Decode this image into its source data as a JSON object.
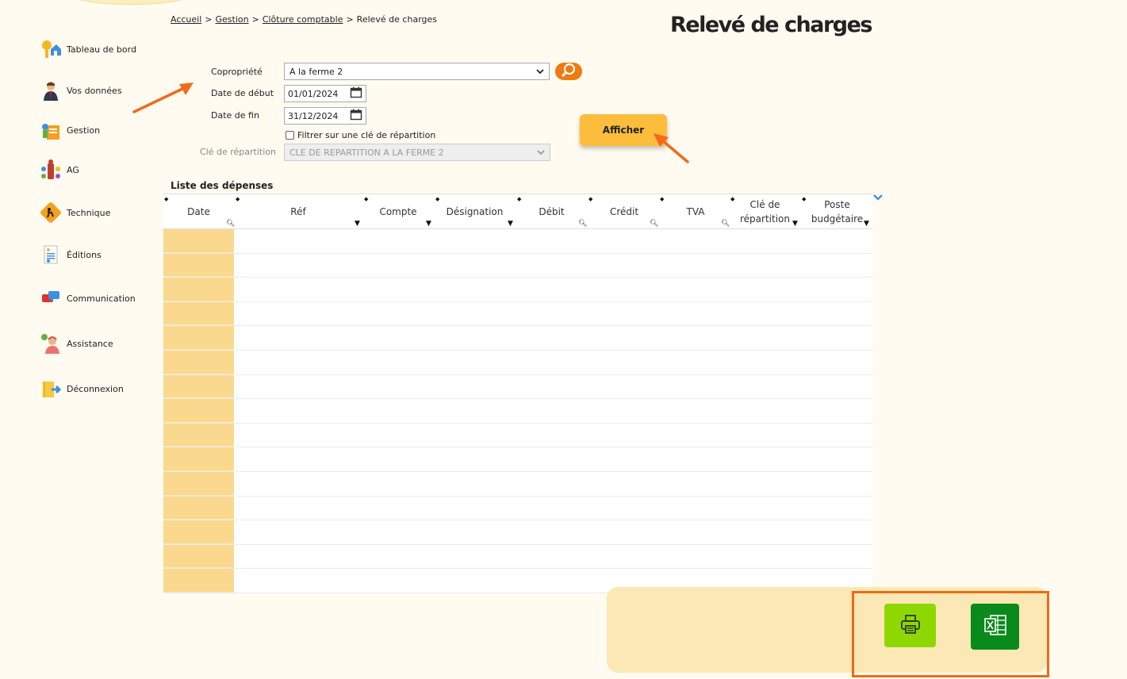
{
  "breadcrumb": {
    "items": [
      "Accueil",
      "Gestion",
      "Clôture comptable"
    ],
    "current": "Relevé de charges",
    "separator": ">"
  },
  "page_title": "Relevé de charges",
  "sidebar": {
    "items": [
      {
        "label": "Tableau de bord",
        "icon": "dashboard-icon"
      },
      {
        "label": "Vos données",
        "icon": "user-icon"
      },
      {
        "label": "Gestion",
        "icon": "management-icon"
      },
      {
        "label": "AG",
        "icon": "meeting-icon"
      },
      {
        "label": "Technique",
        "icon": "worker-icon"
      },
      {
        "label": "Éditions",
        "icon": "document-icon"
      },
      {
        "label": "Communication",
        "icon": "chat-icon"
      },
      {
        "label": "Assistance",
        "icon": "support-icon"
      },
      {
        "label": "Déconnexion",
        "icon": "logout-icon"
      }
    ]
  },
  "form": {
    "copropriete_label": "Copropriété",
    "copropriete_value": "A la ferme 2",
    "date_debut_label": "Date de début",
    "date_debut_value": "01/01/2024",
    "date_fin_label": "Date de fin",
    "date_fin_value": "31/12/2024",
    "filter_checkbox_label": "Filtrer sur une clé de répartition",
    "filter_checked": false,
    "cle_label": "Clé de répartition",
    "cle_value": "CLE DE REPARTITION A LA FERME 2",
    "afficher_label": "Afficher"
  },
  "table": {
    "title": "Liste des dépenses",
    "columns": [
      "Date",
      "Réf",
      "Compte",
      "Désignation",
      "Débit",
      "Crédit",
      "TVA",
      "Clé de répartition",
      "Poste budgétaire"
    ],
    "rows": 15
  },
  "colors": {
    "accent_orange": "#f07a10",
    "button_yellow": "#fbbd3b",
    "date_column": "#fad88e",
    "print_green": "#8fd700",
    "excel_green": "#0a8a1a",
    "highlight": "#ef6a15"
  },
  "actions": {
    "print_icon": "printer-icon",
    "excel_icon": "excel-icon"
  }
}
